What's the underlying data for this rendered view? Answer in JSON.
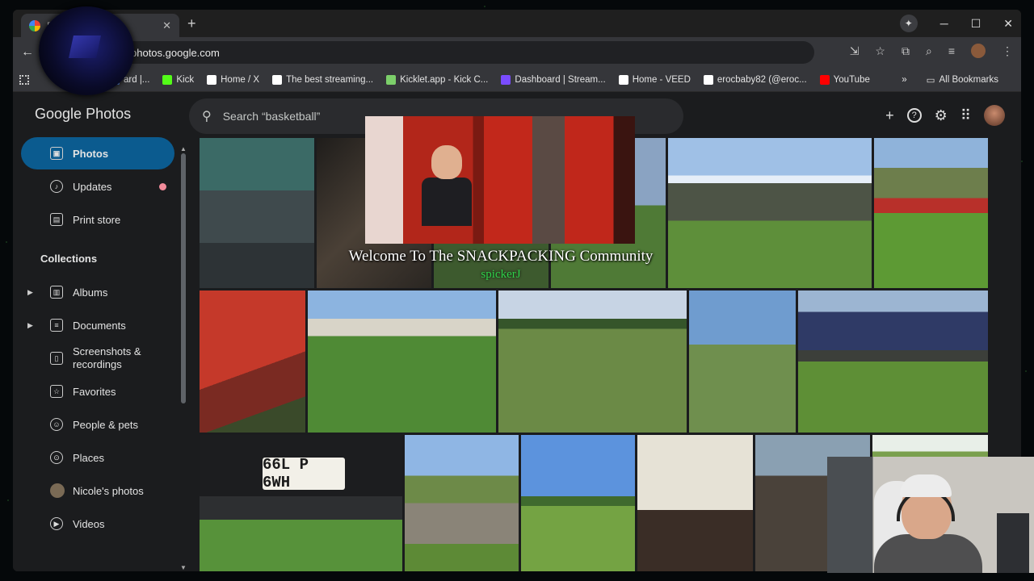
{
  "browser": {
    "tab_title": "P",
    "url": "photos.google.com",
    "bookmarks": [
      {
        "label": "ard |...",
        "icon": "dashboard-icon",
        "color": "#6aa0ff"
      },
      {
        "label": "Kick",
        "icon": "kick-icon",
        "color": "#53fc18"
      },
      {
        "label": "Home / X",
        "icon": "x-icon",
        "color": "#ffffff"
      },
      {
        "label": "The best streaming...",
        "icon": "diamond-icon",
        "color": "#ffffff"
      },
      {
        "label": "Kicklet.app - Kick C...",
        "icon": "kicklet-icon",
        "color": "#7ccf6a"
      },
      {
        "label": "Dashboard | Stream...",
        "icon": "sl-icon",
        "color": "#7a4cff"
      },
      {
        "label": "Home - VEED",
        "icon": "veed-icon",
        "color": "#ffffff"
      },
      {
        "label": "erocbaby82 (@eroc...",
        "icon": "tiktok-icon",
        "color": "#ffffff"
      },
      {
        "label": "YouTube",
        "icon": "youtube-icon",
        "color": "#ff0000"
      }
    ],
    "all_bookmarks": "All Bookmarks"
  },
  "app": {
    "logo_google": "Google",
    "logo_photos": "Photos",
    "search_placeholder": "Search “basketball”"
  },
  "sidebar": {
    "items": [
      {
        "label": "Photos",
        "icon": "photo-icon",
        "active": true
      },
      {
        "label": "Updates",
        "icon": "bell-icon",
        "badge": true
      },
      {
        "label": "Print store",
        "icon": "print-store-icon"
      }
    ],
    "collections_title": "Collections",
    "collections": [
      {
        "label": "Albums",
        "icon": "album-icon",
        "expandable": true
      },
      {
        "label": "Documents",
        "icon": "document-icon",
        "expandable": true
      },
      {
        "label": "Screenshots & recordings",
        "icon": "screenshot-icon"
      },
      {
        "label": "Favorites",
        "icon": "star-icon"
      },
      {
        "label": "People & pets",
        "icon": "face-icon"
      },
      {
        "label": "Places",
        "icon": "pin-icon"
      },
      {
        "label": "Nicole's photos",
        "icon": "nicole-avatar"
      },
      {
        "label": "Videos",
        "icon": "play-icon"
      }
    ]
  },
  "overlay": {
    "welcome": "Welcome To The SNACKPACKING Community",
    "username": "spickerJ"
  },
  "photos": {
    "license_plate": "66L P 6WH"
  },
  "colors": {
    "accent_active": "#0b5b8f",
    "badge": "#f28b9b",
    "welcome_user": "#2fd24a"
  }
}
